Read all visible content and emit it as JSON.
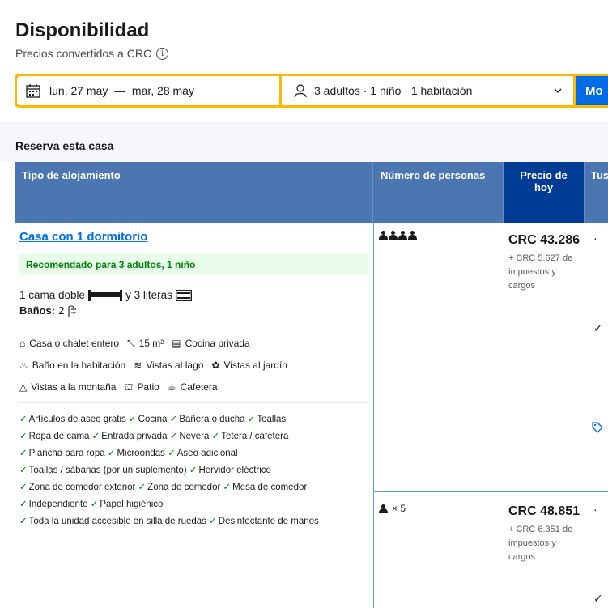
{
  "header": {
    "title": "Disponibilidad",
    "subtitle": "Precios convertidos a CRC",
    "info_icon": "ⓘ"
  },
  "search": {
    "dates": "lun, 27 may  —  mar, 28 may",
    "guests": "3 adultos · 1 niño · 1 habitación",
    "button_label": "Mo"
  },
  "section": {
    "title": "Reserva esta casa"
  },
  "table": {
    "headers": {
      "type": "Tipo de alojamiento",
      "persons": "Número de personas",
      "price": "Precio de hoy",
      "choices": "Tus"
    },
    "room": {
      "name": "Casa con 1 dormitorio",
      "recommended": "Recomendado para 3 adultos, 1 niño",
      "beds_prefix": "1 cama doble",
      "beds_mid": "y 3 literas",
      "baths_label": "Baños:",
      "baths_value": "2",
      "facilities_row1": [
        "Casa o chalet entero",
        "15 m²",
        "Cocina privada"
      ],
      "facilities_row2": [
        "Baño en la habitación",
        "Vistas al lago",
        "Vistas al jardín"
      ],
      "facilities_row3": [
        "Vistas a la montaña",
        "Patio",
        "Cafetera"
      ],
      "amenities": [
        [
          "Artículos de aseo gratis",
          "Cocina",
          "Bañera o ducha",
          "Toallas"
        ],
        [
          "Ropa de cama",
          "Entrada privada",
          "Nevera",
          "Tetera / cafetera"
        ],
        [
          "Plancha para ropa",
          "Microondas",
          "Aseo adicional"
        ],
        [
          "Toallas / sábanas (por un suplemento)",
          "Hervidor eléctrico"
        ],
        [
          "Zona de comedor exterior",
          "Zona de comedor",
          "Mesa de comedor"
        ],
        [
          "Independiente",
          "Papel higiénico"
        ],
        [
          "Toda la unidad accesible en silla de ruedas",
          "Desinfectante de manos"
        ]
      ]
    },
    "options": [
      {
        "persons_count": 4,
        "price": "CRC 43.286",
        "taxes": "+ CRC 5.627 de impuestos y cargos"
      },
      {
        "persons_label": "× 5",
        "price": "CRC 48.851",
        "taxes": "+ CRC 6.351 de impuestos y cargos"
      }
    ]
  },
  "colors": {
    "header_blue": "#4c76b2",
    "price_header": "#003b95",
    "link": "#006ce4",
    "search_border": "#ffb700",
    "green": "#008009"
  }
}
